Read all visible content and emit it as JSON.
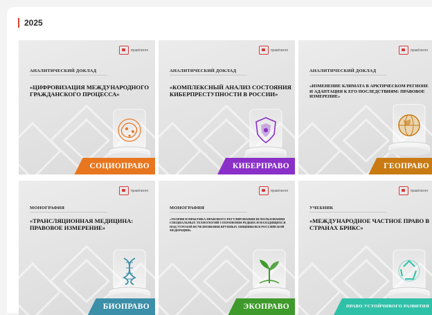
{
  "year": "2025",
  "logo_text": "прав/пигля",
  "cards": [
    {
      "kind": "АНАЛИТИЧЕСКИЙ ДОКЛАД",
      "title": "«ЦИФРОВИЗАЦИЯ МЕЖДУНАРОДНОГО ГРАЖДАНСКОГО ПРОЦЕССА»",
      "badge": "СОЦИОПРАВО",
      "accent": "#e8761e",
      "icon": "brain-circuit-icon"
    },
    {
      "kind": "АНАЛИТИЧЕСКИЙ ДОКЛАД",
      "title": "«КОМПЛЕКСНЫЙ АНАЛИЗ СОСТОЯНИЯ КИБЕРПРЕСТУПНОСТИ В РОССИИ»",
      "badge": "КИБЕРПРАВО",
      "accent": "#8a2fc8",
      "icon": "cyber-shield-icon"
    },
    {
      "kind": "АНАЛИТИЧЕСКИЙ ДОКЛАД",
      "title": "«ИЗМЕНЕНИЕ КЛИМАТА В АРКТИЧЕСКОМ РЕГИОНЕ И АДАПТАЦИЯ К ЕГО ПОСЛЕДСТВИЯМ: ПРАВОВОЕ ИЗМЕРЕНИЕ»",
      "badge": "ГЕОПРАВО",
      "accent": "#c97a12",
      "icon": "globe-icon"
    },
    {
      "kind": "МОНОГРАФИЯ",
      "title": "«ТРАНСЛЯЦИОННАЯ МЕДИЦИНА: ПРАВОВОЕ ИЗМЕРЕНИЕ»",
      "badge": "БИОПРАВО",
      "accent": "#3c8fa8",
      "icon": "dna-icon"
    },
    {
      "kind": "МОНОГРАФИЯ",
      "title": "«ТЕОРИЯ И ПРАКТИКА ПРАВОВОГО РЕГУЛИРОВАНИЯ ИСПОЛЬЗОВАНИЯ СПЕЦИАЛЬНЫХ ТЕХНОЛОГИЙ СОХРАНЕНИЯ РЕДКИХ И НАХОДЯЩИХСЯ ПОД УГРОЗОЙ ИСЧЕЗНОВЕНИЯ КРУПНЫХ ХИЩНИКОВ В РОССИЙСКОЙ ФЕДЕРАЦИИ»",
      "badge": "ЭКОПРАВО",
      "accent": "#3e9a2a",
      "icon": "sprout-icon"
    },
    {
      "kind": "УЧЕБНИК",
      "title": "«МЕЖДУНАРОДНОЕ ЧАСТНОЕ ПРАВО В СТРАНАХ БРИКС»",
      "badge": "ПРАВО УСТОЙЧИВОГО РАЗВИТИЯ",
      "accent": "#2fc0a8",
      "icon": "recycle-icon"
    }
  ]
}
